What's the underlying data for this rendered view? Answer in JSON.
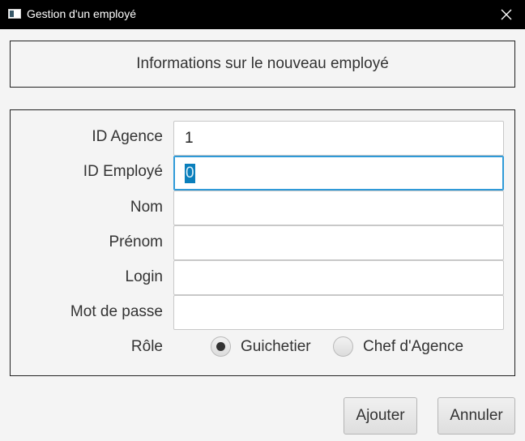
{
  "window": {
    "title": "Gestion d'un employé"
  },
  "header": {
    "text": "Informations sur le nouveau employé"
  },
  "form": {
    "agency_id_label": "ID Agence",
    "agency_id_value": "1",
    "employee_id_label": "ID Employé",
    "employee_id_value": "0",
    "name_label": "Nom",
    "name_value": "",
    "firstname_label": "Prénom",
    "firstname_value": "",
    "login_label": "Login",
    "login_value": "",
    "password_label": "Mot de passe",
    "password_value": "",
    "role_label": "Rôle",
    "roles": [
      {
        "label": "Guichetier",
        "selected": true
      },
      {
        "label": "Chef d'Agence",
        "selected": false
      }
    ]
  },
  "buttons": {
    "add": "Ajouter",
    "cancel": "Annuler"
  },
  "colors": {
    "titlebar": "#000000",
    "focus_border": "#2f9ad8",
    "selection": "#0a7fbc"
  }
}
